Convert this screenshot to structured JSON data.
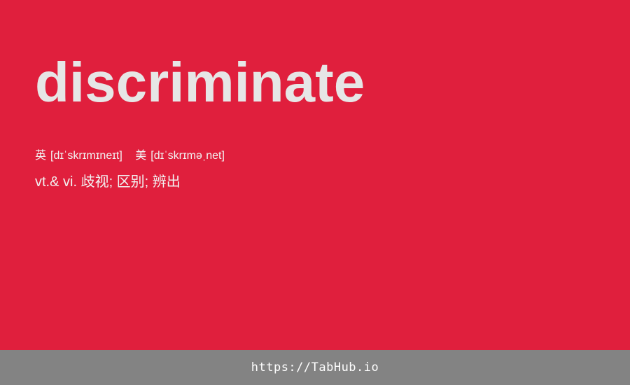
{
  "card": {
    "word": "discriminate",
    "phonetics": {
      "uk": {
        "region": "英",
        "ipa": "[dɪˈskrɪmɪneɪt]"
      },
      "us": {
        "region": "美",
        "ipa": "[dɪˈskrɪməˌnet]"
      }
    },
    "definition": "vt.& vi. 歧视; 区别; 辨出"
  },
  "footer": {
    "link_text": "https://TabHub.io"
  },
  "colors": {
    "card_background": "#e01f3d",
    "word_text": "#e6e6e6",
    "footer_background": "#838383",
    "footer_text": "#ffffff"
  }
}
